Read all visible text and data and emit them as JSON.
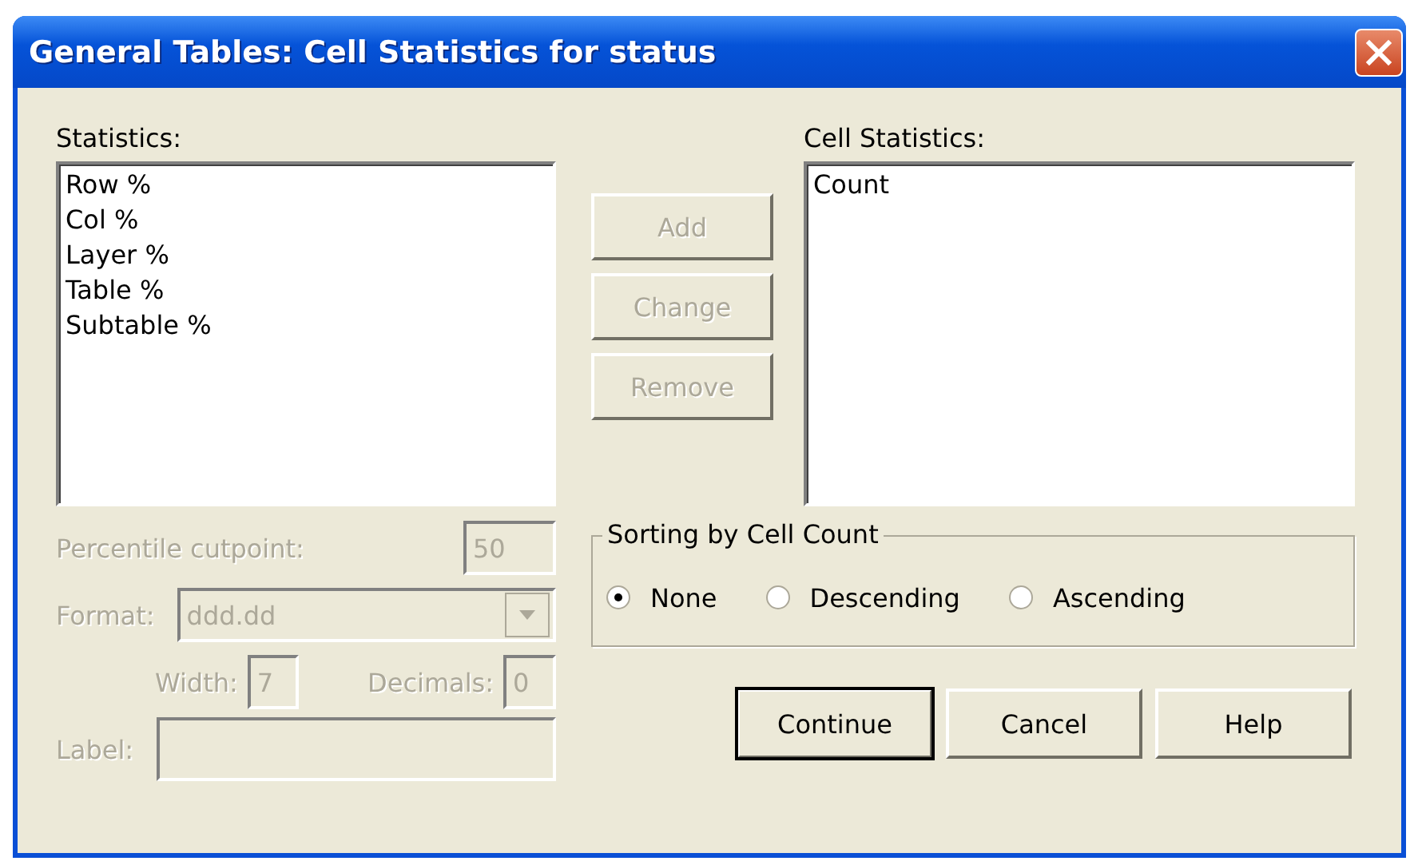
{
  "window": {
    "title": "General Tables: Cell Statistics for status"
  },
  "statistics": {
    "label": "Statistics:",
    "items": [
      "Row %",
      "Col %",
      "Layer %",
      "Table %",
      "Subtable %"
    ]
  },
  "action_buttons": [
    {
      "label": "Add",
      "disabled": true
    },
    {
      "label": "Change",
      "disabled": true
    },
    {
      "label": "Remove",
      "disabled": true
    }
  ],
  "cell_statistics": {
    "label": "Cell Statistics:",
    "items": [
      "Count"
    ]
  },
  "options": {
    "disabled": true,
    "percentile": {
      "label": "Percentile cutpoint:",
      "value": "50"
    },
    "format": {
      "label": "Format:",
      "value": "ddd.dd"
    },
    "width": {
      "label": "Width:",
      "value": "7"
    },
    "decimals": {
      "label": "Decimals:",
      "value": "0"
    },
    "label_field": {
      "label": "Label:"
    }
  },
  "sorting": {
    "title": "Sorting by Cell Count",
    "options": [
      {
        "label": "None",
        "selected": true
      },
      {
        "label": "Descending",
        "selected": false
      },
      {
        "label": "Ascending",
        "selected": false
      }
    ]
  },
  "buttons": [
    {
      "label": "Continue",
      "default": true
    },
    {
      "label": "Cancel",
      "default": false
    },
    {
      "label": "Help",
      "default": false
    }
  ]
}
